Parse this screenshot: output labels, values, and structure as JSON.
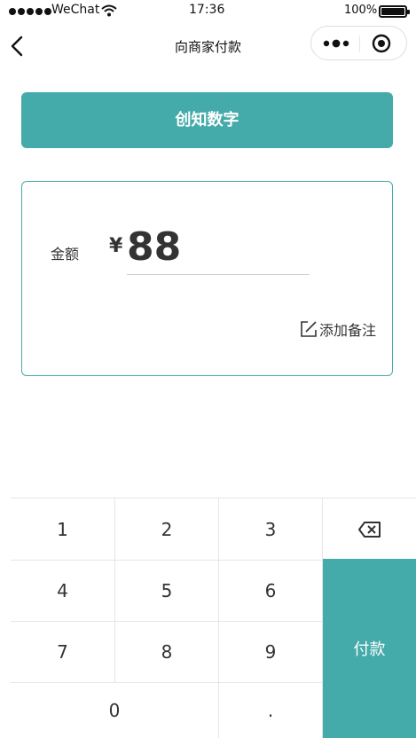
{
  "status_bar": {
    "carrier": "WeChat",
    "time": "17:36",
    "battery": "100%",
    "battery_level": 1.0,
    "icons": [
      "signal-dots-icon",
      "wifi-icon",
      "battery-icon"
    ]
  },
  "nav": {
    "title": "向商家付款",
    "icons": [
      "back-chevron-icon",
      "more-dots-icon",
      "close-target-icon"
    ]
  },
  "merchant": {
    "name": "创知数字"
  },
  "payment": {
    "amount_label": "金额",
    "currency_symbol": "¥",
    "amount": "88",
    "remark_label": "添加备注",
    "remark_icon": "edit-icon"
  },
  "keypad": {
    "keys": {
      "k1": "1",
      "k2": "2",
      "k3": "3",
      "k4": "4",
      "k5": "5",
      "k6": "6",
      "k7": "7",
      "k8": "8",
      "k9": "9",
      "k0": "0",
      "dot": "."
    },
    "backspace_icon": "backspace-icon",
    "pay_label": "付款"
  },
  "colors": {
    "accent": "#45aaaa",
    "background": "#ffffff",
    "text": "#333333",
    "divider": "#e6e6e6"
  }
}
